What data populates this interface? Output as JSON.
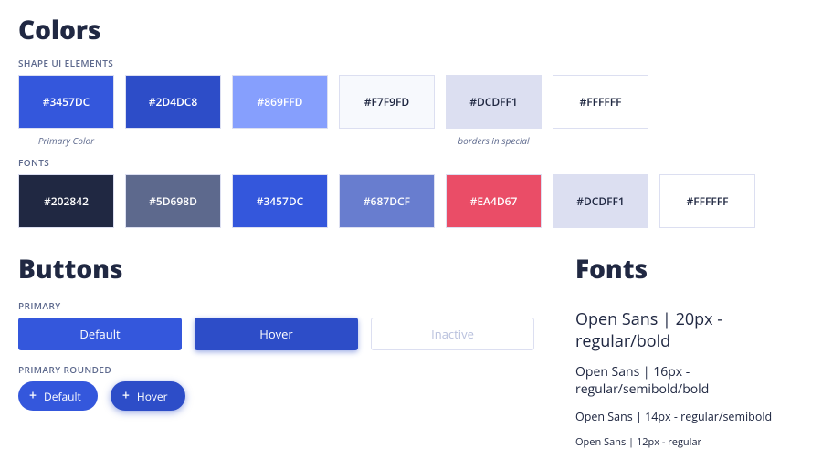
{
  "colors": {
    "title": "Colors",
    "group1": {
      "label": "SHAPE UI ELEMENTS",
      "swatches": [
        {
          "hex": "#3457DC",
          "textClass": "light-text",
          "caption": "Primary Color"
        },
        {
          "hex": "#2D4DC8",
          "textClass": "light-text",
          "caption": ""
        },
        {
          "hex": "#869FFD",
          "textClass": "light-text",
          "caption": ""
        },
        {
          "hex": "#F7F9FD",
          "textClass": "dark-text",
          "caption": ""
        },
        {
          "hex": "#DCDFF1",
          "textClass": "dark-text",
          "caption": "borders in special"
        },
        {
          "hex": "#FFFFFF",
          "textClass": "dark-text",
          "caption": ""
        }
      ]
    },
    "group2": {
      "label": "FONTS",
      "swatches": [
        {
          "hex": "#202842",
          "textClass": "light-text"
        },
        {
          "hex": "#5D698D",
          "textClass": "light-text"
        },
        {
          "hex": "#3457DC",
          "textClass": "light-text"
        },
        {
          "hex": "#687DCF",
          "textClass": "light-text"
        },
        {
          "hex": "#EA4D67",
          "textClass": "light-text"
        },
        {
          "hex": "#DCDFF1",
          "textClass": "dark-text"
        },
        {
          "hex": "#FFFFFF",
          "textClass": "dark-text"
        }
      ]
    }
  },
  "buttons": {
    "title": "Buttons",
    "primary_label": "PRIMARY",
    "primary": {
      "default": "Default",
      "hover": "Hover",
      "inactive": "Inactive"
    },
    "rounded_label": "PRIMARY ROUNDED",
    "rounded": {
      "default": "Default",
      "hover": "Hover"
    }
  },
  "fonts": {
    "title": "Fonts",
    "specs": [
      "Open Sans | 20px - regular/bold",
      "Open Sans | 16px - regular/semibold/bold",
      "Open Sans | 14px - regular/semibold",
      "Open Sans | 12px - regular"
    ]
  }
}
